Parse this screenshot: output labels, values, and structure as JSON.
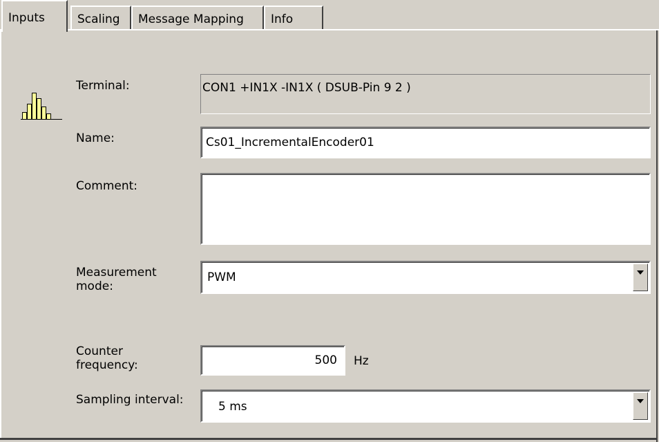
{
  "tabs": [
    {
      "label": "Inputs",
      "active": true
    },
    {
      "label": "Scaling",
      "active": false
    },
    {
      "label": "Message Mapping",
      "active": false
    },
    {
      "label": "Info",
      "active": false
    }
  ],
  "icon": "histogram-icon",
  "form": {
    "terminal_label": "Terminal:",
    "terminal_value": "CON1  +IN1X  -IN1X   ( DSUB-Pin  9  2 )",
    "name_label": "Name:",
    "name_value": "Cs01_IncrementalEncoder01",
    "comment_label": "Comment:",
    "comment_value": "",
    "measurement_label_line1": "Measurement",
    "measurement_label_line2": "mode:",
    "measurement_value": "PWM",
    "counter_label_line1": "Counter",
    "counter_label_line2": "frequency:",
    "counter_value": "500",
    "counter_unit": "Hz",
    "sampling_label": "Sampling interval:",
    "sampling_value": "5  ms"
  }
}
